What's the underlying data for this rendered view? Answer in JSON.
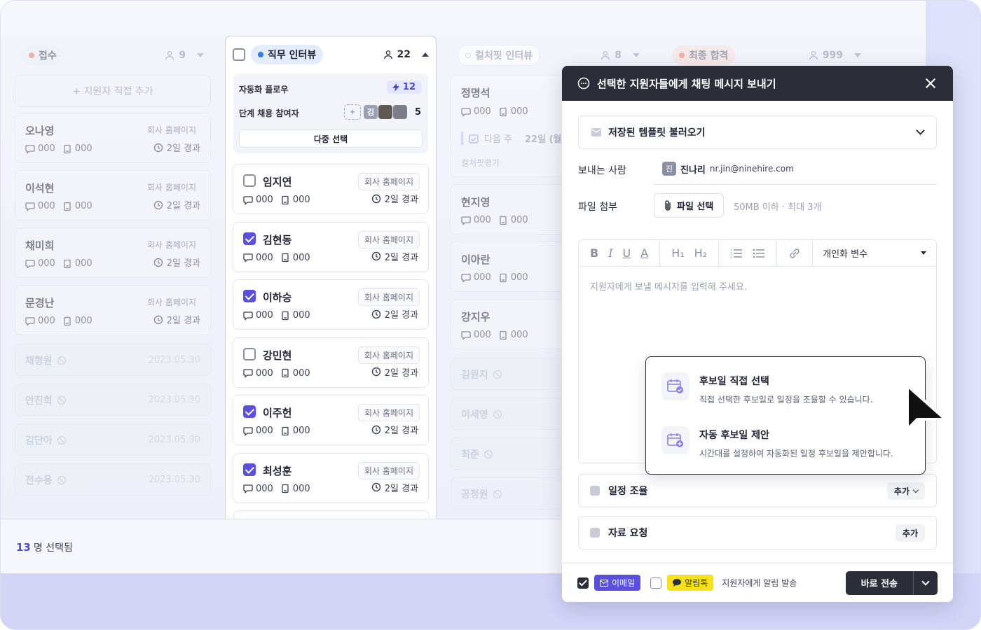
{
  "board": {
    "columns": [
      {
        "title": "접수",
        "count": "9",
        "color": "#f07b5e"
      },
      {
        "title": "직무 인터뷰",
        "count": "22",
        "color": "#2f7bea"
      },
      {
        "title": "컬처핏 인터뷰",
        "count": "8",
        "color": "#d0d3de"
      },
      {
        "title": "최종 합격",
        "count": "999",
        "color": "#f07b5e"
      }
    ],
    "add_applicant": "+ 지원자 직접 추가",
    "col1_cards": [
      {
        "name": "오나영",
        "source": "회사 홈페이지",
        "comments": "000",
        "docs": "000",
        "elapsed": "2일 경과"
      },
      {
        "name": "이석현",
        "source": "회사 홈페이지",
        "comments": "000",
        "docs": "000",
        "elapsed": "2일 경과"
      },
      {
        "name": "채미희",
        "source": "회사 홈페이지",
        "comments": "000",
        "docs": "000",
        "elapsed": "2일 경과"
      },
      {
        "name": "문경난",
        "source": "회사 홈페이지",
        "comments": "000",
        "docs": "000",
        "elapsed": "2일 경과"
      }
    ],
    "col1_dim": [
      {
        "name": "채형원",
        "date": "2023.05.30"
      },
      {
        "name": "안진희",
        "date": "2023.05.30"
      },
      {
        "name": "김단아",
        "date": "2023.05.30"
      },
      {
        "name": "전수용",
        "date": "2023.05.30"
      }
    ],
    "automation": {
      "flow_label": "자동화 플로우",
      "flow_count": "12",
      "participants_label": "단계 채용 참여자",
      "participants_count": "5",
      "avatar_initial": "김",
      "multi_select": "다중 선택"
    },
    "col2_cards": [
      {
        "name": "임지연",
        "source": "회사 홈페이지",
        "comments": "000",
        "docs": "000",
        "elapsed": "2일 경과",
        "checked": false
      },
      {
        "name": "김현동",
        "source": "회사 홈페이지",
        "comments": "000",
        "docs": "000",
        "elapsed": "2일 경과",
        "checked": true
      },
      {
        "name": "이하승",
        "source": "회사 홈페이지",
        "comments": "000",
        "docs": "000",
        "elapsed": "2일 경과",
        "checked": true
      },
      {
        "name": "강민현",
        "source": "회사 홈페이지",
        "comments": "000",
        "docs": "000",
        "elapsed": "2일 경과",
        "checked": false
      },
      {
        "name": "이주헌",
        "source": "회사 홈페이지",
        "comments": "000",
        "docs": "000",
        "elapsed": "2일 경과",
        "checked": true
      },
      {
        "name": "최성훈",
        "source": "회사 홈페이지",
        "comments": "000",
        "docs": "000",
        "elapsed": "2일 경과",
        "checked": true
      }
    ],
    "col3_cards": [
      {
        "name": "정명석",
        "comments": "000",
        "docs": "000",
        "schedule": "다음 주",
        "schedule_date": "22일 (월)",
        "sub": "컬처핏평가"
      },
      {
        "name": "현지영",
        "comments": "000",
        "docs": "000"
      },
      {
        "name": "이아란",
        "comments": "000",
        "docs": "000"
      },
      {
        "name": "강지우",
        "comments": "000",
        "docs": "000"
      }
    ],
    "col3_dim": [
      "김원지",
      "이세영",
      "최준",
      "공정원"
    ]
  },
  "selection_bar": {
    "count": "13",
    "label": "명 선택됨"
  },
  "modal": {
    "title": "선택한 지원자들에게 채팅 메시지 보내기",
    "template_label": "저장된 템플릿 불러오기",
    "sender_label": "보내는 사람",
    "sender_initial": "진",
    "sender_name": "진나리",
    "sender_email": "nr.jin@ninehire.com",
    "attach_label": "파일 첨부",
    "attach_button": "파일 선택",
    "attach_hint": "50MB 이하 · 최대 3개",
    "toolbar": {
      "bold": "B",
      "italic": "I",
      "underline": "U",
      "color": "A",
      "h1": "H₁",
      "h2": "H₂",
      "variables": "개인화 변수"
    },
    "message_placeholder": "지원자에게 보낼 메시지를 입력해 주세요.",
    "popover": [
      {
        "title": "후보일 직접 선택",
        "desc": "직접 선택한 후보일로 일정을 조율할 수 있습니다."
      },
      {
        "title": "자동 후보일 제안",
        "desc": "시간대를 설정하여 자동화된 일정 후보일을 제안합니다."
      }
    ],
    "schedule_label": "일정 조율",
    "schedule_add": "추가",
    "request_label": "자료 요청",
    "request_add": "추가",
    "footer": {
      "email_tag": "이메일",
      "email_checked": true,
      "talk_tag": "알림톡",
      "talk_checked": false,
      "note": "지원자에게 알림 발송",
      "send": "바로 전송"
    }
  }
}
